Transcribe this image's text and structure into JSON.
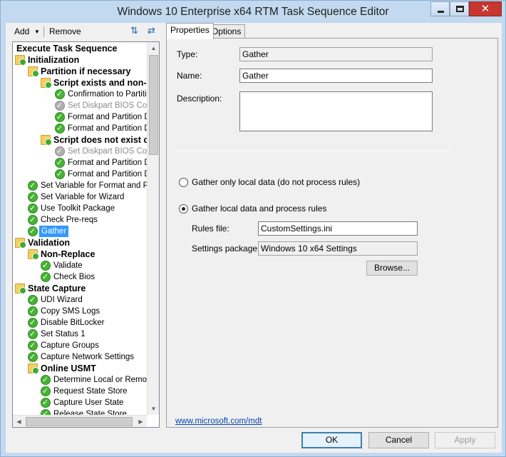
{
  "window": {
    "title": "Windows 10 Enterprise x64 RTM Task Sequence Editor"
  },
  "toolbar": {
    "add_label": "Add",
    "remove_label": "Remove"
  },
  "tree": {
    "items": [
      {
        "label": "Execute Task Sequence",
        "kind": "root",
        "state": "normal"
      },
      {
        "label": "Initialization",
        "kind": "group",
        "state": "normal"
      },
      {
        "label": "Partition if necessary",
        "kind": "group",
        "state": "normal"
      },
      {
        "label": "Script exists and non-N",
        "kind": "group",
        "state": "normal"
      },
      {
        "label": "Confirmation to Partition",
        "kind": "step",
        "state": "normal"
      },
      {
        "label": "Set Diskpart BIOS Com",
        "kind": "step",
        "state": "disabled"
      },
      {
        "label": "Format and Partition Dis",
        "kind": "step",
        "state": "normal"
      },
      {
        "label": "Format and Partition Dis",
        "kind": "step",
        "state": "normal"
      },
      {
        "label": "Script does not exist or",
        "kind": "group",
        "state": "normal"
      },
      {
        "label": "Set Diskpart BIOS Com",
        "kind": "step",
        "state": "disabled"
      },
      {
        "label": "Format and Partition Dis",
        "kind": "step",
        "state": "normal"
      },
      {
        "label": "Format and Partition Dis",
        "kind": "step",
        "state": "normal"
      },
      {
        "label": "Set Variable for Format and Par",
        "kind": "step",
        "state": "normal"
      },
      {
        "label": "Set Variable for Wizard",
        "kind": "step",
        "state": "normal"
      },
      {
        "label": "Use Toolkit Package",
        "kind": "step",
        "state": "normal"
      },
      {
        "label": "Check Pre-reqs",
        "kind": "step",
        "state": "normal"
      },
      {
        "label": "Gather",
        "kind": "step",
        "state": "selected"
      },
      {
        "label": "Validation",
        "kind": "group",
        "state": "normal"
      },
      {
        "label": "Non-Replace",
        "kind": "group",
        "state": "normal"
      },
      {
        "label": "Validate",
        "kind": "step",
        "state": "normal"
      },
      {
        "label": "Check Bios",
        "kind": "step",
        "state": "normal"
      },
      {
        "label": "State Capture",
        "kind": "group",
        "state": "normal"
      },
      {
        "label": "UDI Wizard",
        "kind": "step",
        "state": "normal"
      },
      {
        "label": "Copy SMS Logs",
        "kind": "step",
        "state": "normal"
      },
      {
        "label": "Disable BitLocker",
        "kind": "step",
        "state": "normal"
      },
      {
        "label": "Set Status 1",
        "kind": "step",
        "state": "normal"
      },
      {
        "label": "Capture Groups",
        "kind": "step",
        "state": "normal"
      },
      {
        "label": "Capture Network Settings",
        "kind": "step",
        "state": "normal"
      },
      {
        "label": "Online USMT",
        "kind": "group",
        "state": "normal"
      },
      {
        "label": "Determine Local or Remote",
        "kind": "step",
        "state": "normal"
      },
      {
        "label": "Request State Store",
        "kind": "step",
        "state": "normal"
      },
      {
        "label": "Capture User State",
        "kind": "step",
        "state": "normal"
      },
      {
        "label": "Release State Store",
        "kind": "step",
        "state": "normal"
      }
    ]
  },
  "tabs": [
    {
      "label": "Properties",
      "active": true
    },
    {
      "label": "Options",
      "active": false
    }
  ],
  "properties": {
    "type_label": "Type:",
    "type_value": "Gather",
    "name_label": "Name:",
    "name_value": "Gather",
    "description_label": "Description:",
    "description_value": "",
    "radio_local_only": "Gather only local data (do not process rules)",
    "radio_process_rules": "Gather local data and process rules",
    "selected_radio": "process_rules",
    "rules_file_label": "Rules file:",
    "rules_file_value": "CustomSettings.ini",
    "settings_package_label": "Settings package:",
    "settings_package_value": "Windows 10 x64 Settings",
    "browse_label": "Browse...",
    "link_text": "www.microsoft.com/mdt"
  },
  "buttons": {
    "ok": "OK",
    "cancel": "Cancel",
    "apply": "Apply"
  }
}
